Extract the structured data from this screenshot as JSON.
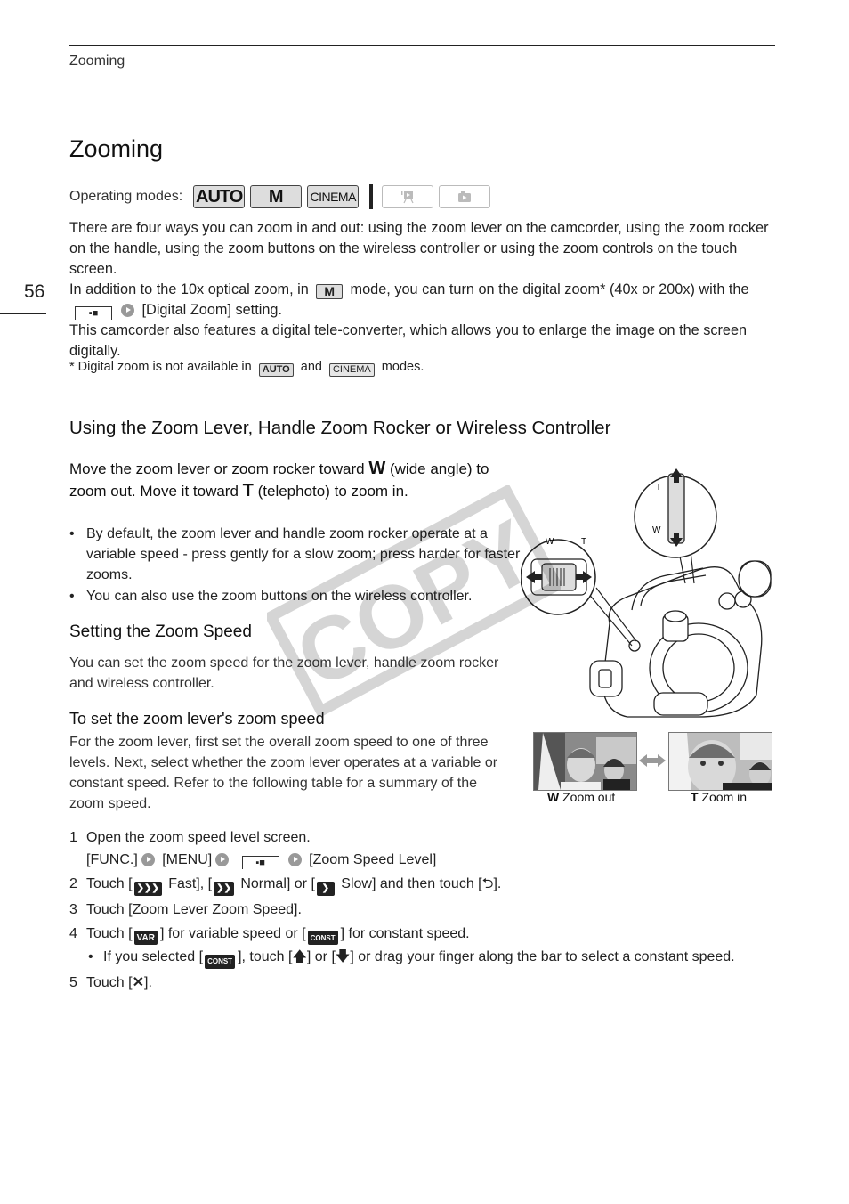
{
  "header": {
    "running_title": "Zooming",
    "page_number": "56"
  },
  "title": "Zooming",
  "operating_modes": {
    "label": "Operating modes:",
    "modes": [
      {
        "name": "AUTO",
        "active": true
      },
      {
        "name": "M",
        "active": true
      },
      {
        "name": "CINEMA",
        "active": true
      },
      {
        "name": "movie-playback",
        "active": false
      },
      {
        "name": "photo-playback",
        "active": false
      }
    ]
  },
  "intro": {
    "p1": "There are four ways you can zoom in and out: using the zoom lever on the camcorder, using the zoom rocker on the handle, using the zoom buttons on the wireless controller or using the zoom controls on the touch screen.",
    "p2_a": "In addition to the 10x optical zoom, in",
    "p2_badge": "M",
    "p2_b": "mode, you can turn on the digital zoom* (40x or 200x) with the",
    "p2_c": "[Digital Zoom] setting.",
    "p3": "This camcorder also features a digital tele-converter, which allows you to enlarge the image on the screen digitally.",
    "footnote_a": "* Digital zoom is not available in",
    "footnote_badge1": "AUTO",
    "footnote_and": "and",
    "footnote_badge2": "CINEMA",
    "footnote_b": "modes."
  },
  "section1": {
    "heading": "Using the Zoom Lever, Handle Zoom Rocker or Wireless Controller",
    "lead_a": "Move the zoom lever or zoom rocker toward",
    "lead_w": "W",
    "lead_b": "(wide angle) to zoom out. Move it toward",
    "lead_t": "T",
    "lead_c": "(telephoto) to zoom in.",
    "bullets": [
      "By default, the zoom lever and handle zoom rocker operate at a variable speed - press gently for a slow zoom; press harder for faster zooms.",
      "You can also use the zoom buttons on the wireless controller."
    ],
    "illustration": {
      "rocker_labels": {
        "w": "W",
        "t": "T"
      },
      "handle_labels": {
        "t": "T",
        "w": "W"
      }
    },
    "photos": {
      "left_caption_bold": "W",
      "left_caption": "Zoom out",
      "right_caption_bold": "T",
      "right_caption": "Zoom in"
    }
  },
  "section2": {
    "heading": "Setting the Zoom Speed",
    "text": "You can set the zoom speed for the zoom lever, handle zoom rocker and wireless controller.",
    "sub_heading": "To set the zoom lever's zoom speed",
    "sub_text": "For the zoom lever, first set the overall zoom speed to one of three levels. Next, select whether the zoom lever operates at a variable or constant speed. Refer to the following table for a summary of the zoom speed."
  },
  "steps": {
    "s1": {
      "n": "1",
      "text": "Open the zoom speed level screen.",
      "path_func": "[FUNC.]",
      "path_menu": "[MENU]",
      "path_end": "[Zoom Speed Level]"
    },
    "s2": {
      "n": "2",
      "a": "Touch [",
      "fast": "Fast], [",
      "normal": "Normal] or [",
      "slow": "Slow] and then touch [",
      "end": "]."
    },
    "s3": {
      "n": "3",
      "text": "Touch [Zoom Lever Zoom Speed]."
    },
    "s4": {
      "n": "4",
      "a": "Touch [",
      "var": "VAR",
      "b": "] for variable speed or [",
      "const": "CONST",
      "c": "] for constant speed.",
      "sub_a": "If you selected [",
      "sub_const": "CONST",
      "sub_b": "], touch [",
      "sub_c": "] or [",
      "sub_d": "] or drag your finger along the bar to select a constant speed."
    },
    "s5": {
      "n": "5",
      "a": "Touch [",
      "b": "]."
    }
  },
  "watermark": "COPY"
}
